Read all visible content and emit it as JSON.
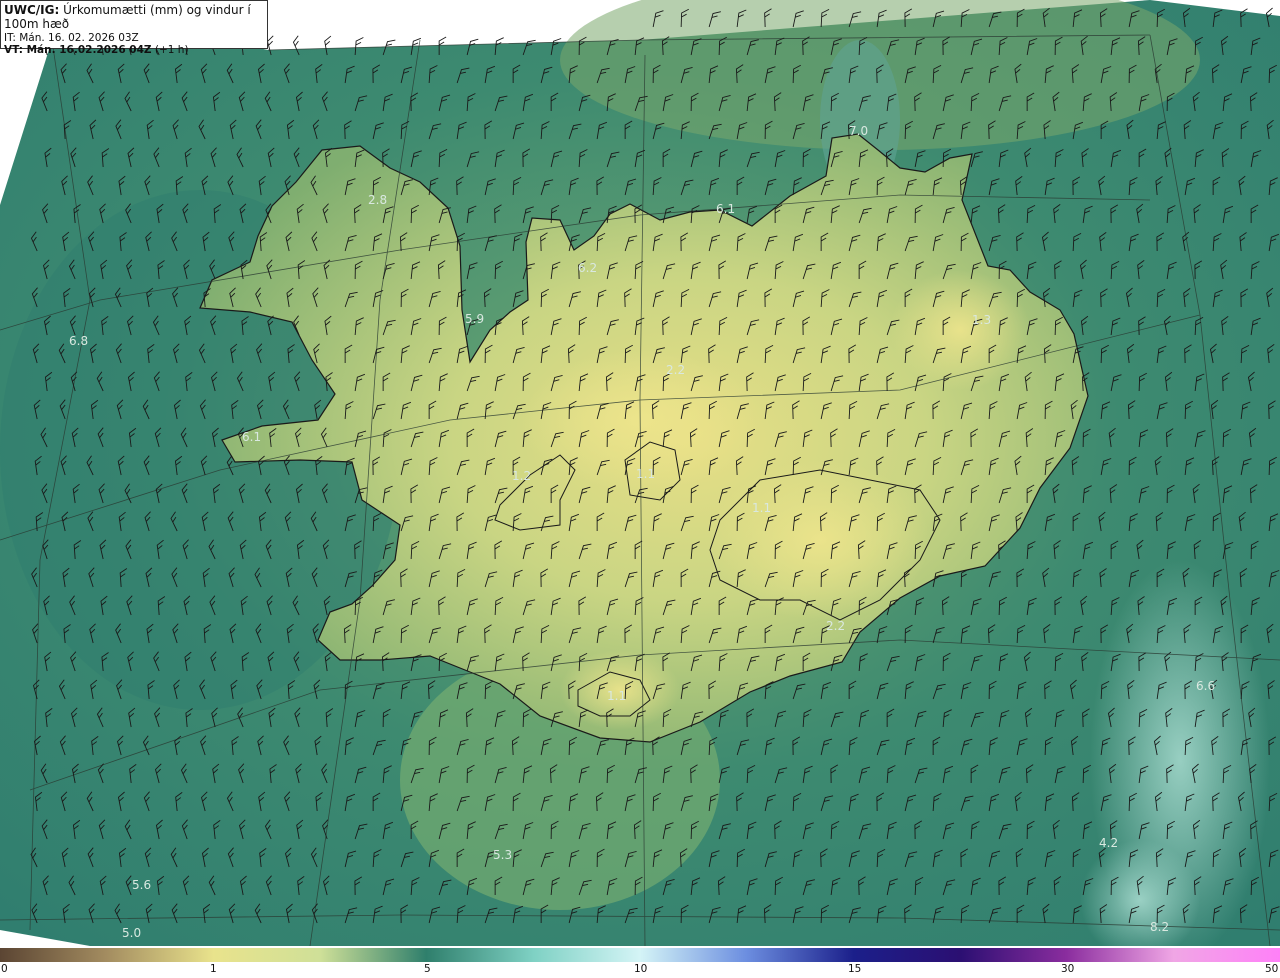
{
  "header": {
    "model": "UWC/IG:",
    "title": "Úrkomumætti (mm) og vindur í 100m hæð",
    "init_time": "IT: Mán. 16. 02. 2026 03Z",
    "valid_label": "VT:",
    "valid_time": "Mán. 16.02.2026 04Z",
    "lead": "(+1 h)"
  },
  "map": {
    "labels": [
      "7.0",
      "2.8",
      "6.1",
      "6.2",
      "5.9",
      "6.8",
      "2.2",
      "1.3",
      "6.1",
      "1.2",
      "1.1",
      "1.1",
      "2.2",
      "1.1",
      "6.6",
      "4.2",
      "5.3",
      "5.6",
      "5.0",
      "8.2"
    ]
  },
  "colorbar": {
    "ticks": [
      "0",
      "1",
      "5",
      "10",
      "15",
      "30",
      "50"
    ],
    "colors": [
      "#5b4533",
      "#a38c60",
      "#e9e38c",
      "#cfe098",
      "#2f7f6c",
      "#7fd1c4",
      "#d4f4f6",
      "#6c8ee0",
      "#1b1f8a",
      "#2b0f72",
      "#8a2d9e",
      "#f0a6e5",
      "#ff80f8"
    ]
  }
}
